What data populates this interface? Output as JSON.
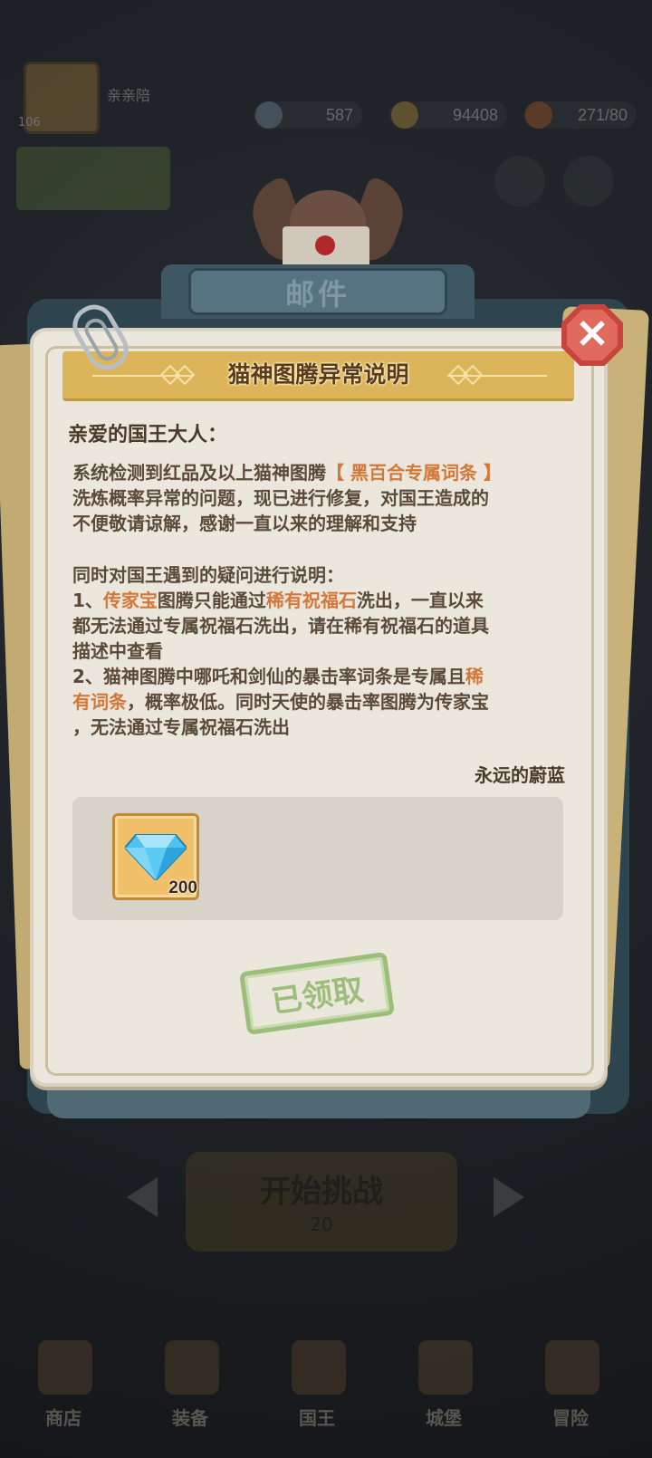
{
  "hud": {
    "level": "106",
    "player_name": "亲亲陪",
    "resources": [
      "587",
      "94408",
      "271/80"
    ]
  },
  "mail": {
    "header_title": "邮件",
    "close_glyph": "✕",
    "title": "猫神图腾异常说明",
    "greeting": "亲爱的国王大人：",
    "para1": {
      "line1_prefix": "系统检测到红品及以上猫神图腾",
      "line1_highlight": "【 黑百合专属词条 】",
      "line2": "洗炼概率异常的问题，现已进行修复，对国王造成的",
      "line3": "不便敬请谅解，感谢一直以来的理解和支持"
    },
    "para2": {
      "line1": "同时对国王遇到的疑问进行说明：",
      "item1_prefix": "1、",
      "item1_hl1": "传家宝",
      "item1_mid": "图腾只能通过",
      "item1_hl2": "稀有祝福石",
      "item1_suffix": "洗出，一直以来",
      "item1_line2": "都无法通过专属祝福石洗出，请在稀有祝福石的道具",
      "item1_line3": "描述中查看",
      "item2_prefix": "2、猫神图腾中哪吒和剑仙的暴击率词条是专属且",
      "item2_hl_a": "稀",
      "item2_hl_b": "有词条",
      "item2_line2_suffix": "，概率极低。同时天使的暴击率图腾为传家宝",
      "item2_line3": "，无法通过专属祝福石洗出"
    },
    "signature": "永远的蔚蓝",
    "reward": {
      "icon": "diamond-icon",
      "count": "200"
    },
    "claimed_label": "已领取"
  },
  "background": {
    "start_label": "开始挑战",
    "start_cost": "20",
    "nav": [
      "商店",
      "装备",
      "国王",
      "城堡",
      "冒险"
    ]
  },
  "colors": {
    "highlight": "#d2783a",
    "title_bar": "#dcb45a",
    "close_button": "#c8453d",
    "claimed_stamp": "#9bbf7a"
  }
}
